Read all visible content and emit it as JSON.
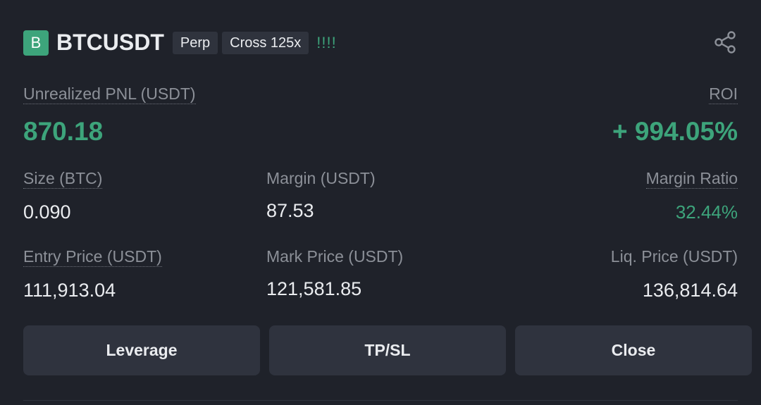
{
  "header": {
    "side_badge": "B",
    "symbol": "BTCUSDT",
    "tags": [
      "Perp",
      "Cross 125x"
    ],
    "signal": "!!!!",
    "share_icon": "share-icon"
  },
  "pnl": {
    "label": "Unrealized PNL (USDT)",
    "value": "870.18"
  },
  "roi": {
    "label": "ROI",
    "value": "+ 994.05%"
  },
  "size": {
    "label": "Size (BTC)",
    "value": "0.090"
  },
  "margin": {
    "label": "Margin (USDT)",
    "value": "87.53"
  },
  "margin_ratio": {
    "label": "Margin Ratio",
    "value": "32.44%"
  },
  "entry_price": {
    "label": "Entry Price (USDT)",
    "value": "111,913.04"
  },
  "mark_price": {
    "label": "Mark Price (USDT)",
    "value": "121,581.85"
  },
  "liq_price": {
    "label": "Liq. Price (USDT)",
    "value": "136,814.64"
  },
  "buttons": {
    "leverage": "Leverage",
    "tpsl": "TP/SL",
    "close": "Close"
  },
  "colors": {
    "background": "#1f222a",
    "positive": "#3da47b",
    "button_bg": "#2f333e",
    "muted_text": "#8c9098"
  }
}
